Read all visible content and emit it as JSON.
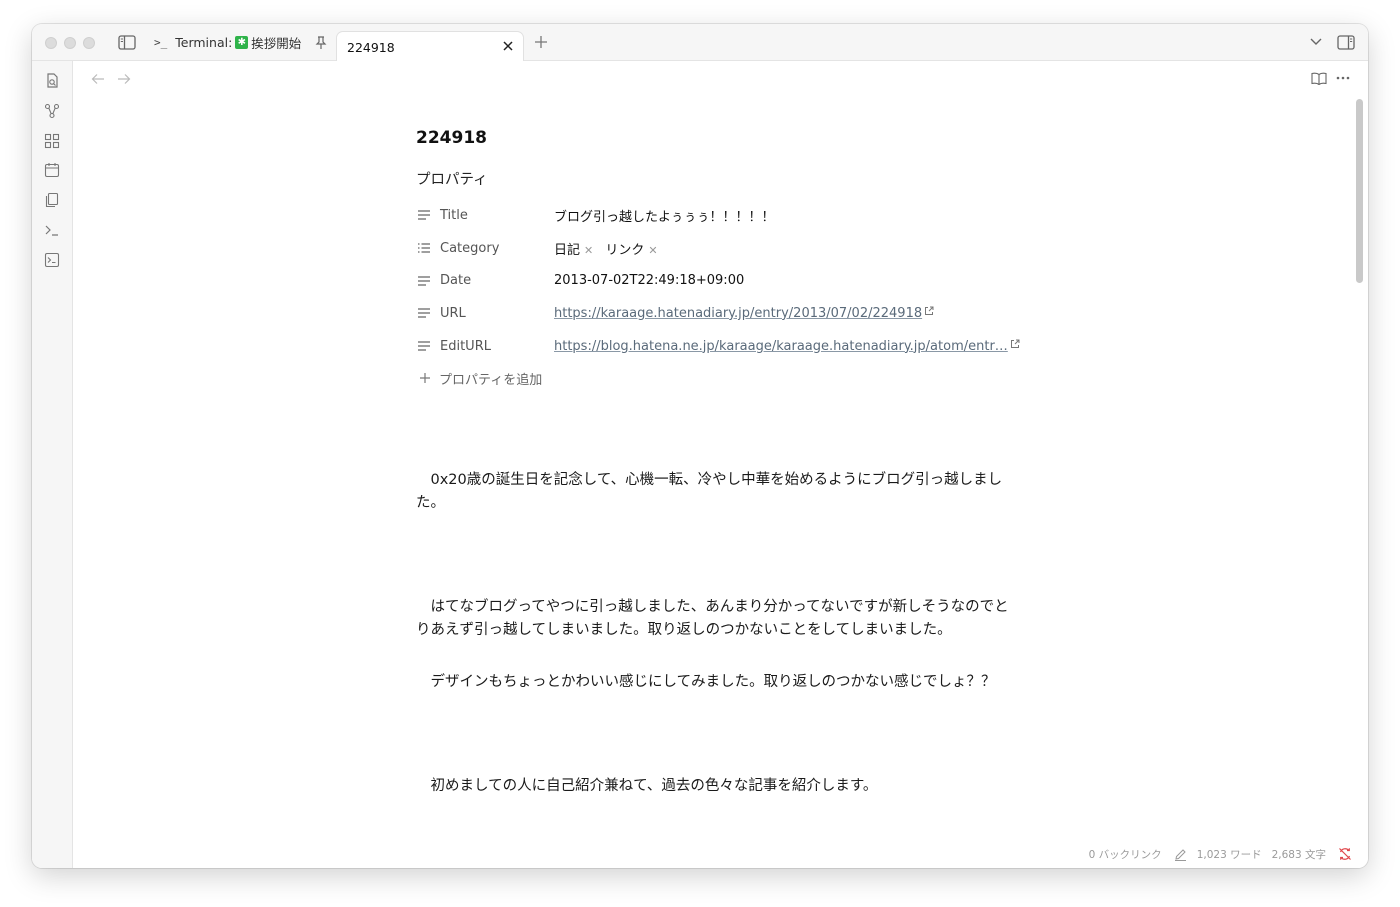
{
  "tabs": [
    {
      "label": "Terminal:",
      "emoji_text": "挨拶開始",
      "prompt": ">_"
    },
    {
      "label": "224918",
      "active": true
    }
  ],
  "note": {
    "title": "224918",
    "properties_heading": "プロパティ",
    "properties": [
      {
        "key": "Title",
        "value": "ブログ引っ越したよぅぅぅ！！！！！",
        "icon": "text-lines-icon"
      },
      {
        "key": "Category",
        "tags": [
          "日記",
          "リンク"
        ],
        "icon": "list-icon"
      },
      {
        "key": "Date",
        "value": "2013-07-02T22:49:18+09:00",
        "icon": "text-lines-icon"
      },
      {
        "key": "URL",
        "value": "https://karaage.hatenadiary.jp/entry/2013/07/02/224918",
        "icon": "text-lines-icon"
      },
      {
        "key": "EditURL",
        "value": "https://blog.hatena.ne.jp/karaage/karaage.hatenadiary.jp/atom/entr…",
        "icon": "text-lines-icon"
      }
    ],
    "add_property_label": "プロパティを追加",
    "paragraphs": [
      "　0x20歳の誕生日を記念して、心機一転、冷やし中華を始めるようにブログ引っ越しました。",
      "　はてなブログってやつに引っ越しました、あんまり分かってないですが新しそうなのでとりあえず引っ越してしまいました。取り返しのつかないことをしてしまいました。",
      "　デザインもちょっとかわいい感じにしてみました。取り返しのつかない感じでしょ？？",
      "　初めましての人に自己紹介兼ねて、過去の色々な記事を紹介します。"
    ]
  },
  "status": {
    "backlinks": "0 バックリンク",
    "words": "1,023 ワード",
    "chars": "2,683 文字"
  },
  "colors": {
    "accent_link": "#5a6a7a",
    "sync_error": "#e0474c",
    "terminal_emoji": "#2fb34a"
  }
}
